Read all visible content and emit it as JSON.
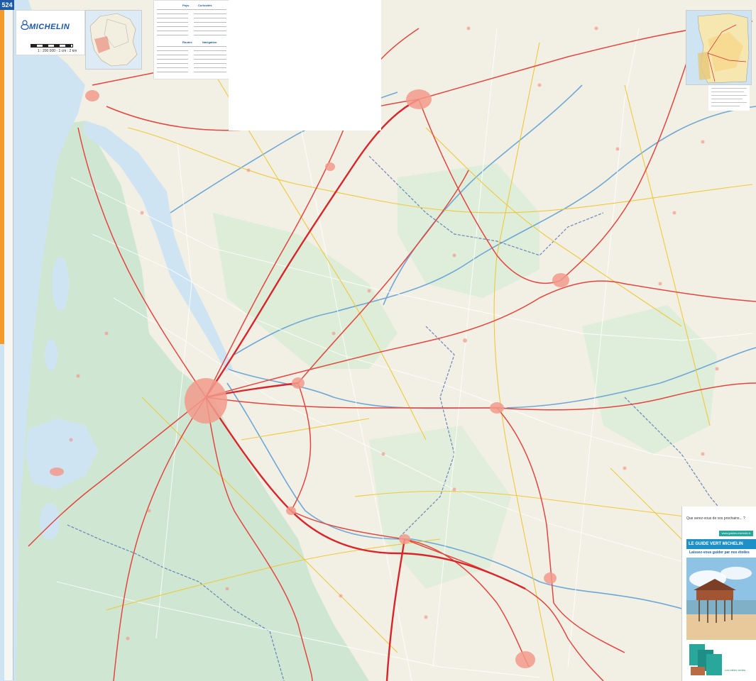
{
  "brand": {
    "name": "MICHELIN",
    "scale": "1 : 200 000 - 1 cm : 2 km",
    "page_tag": "524"
  },
  "legend": {
    "sections": [
      "Pays",
      "Curiosités",
      "Routes",
      "Navigation"
    ]
  },
  "promo": {
    "question": "Que serez-vous de vos prochains... ?",
    "badge": "www.guides.michelin.fr",
    "band": "LE GUIDE VERT MICHELIN",
    "tagline": "Laissez-vous guider par nos étoiles",
    "footer": "Les idées vertes"
  },
  "colors": {
    "sea": "#cfe4f2",
    "forest": "#cbe6cf",
    "land": "#f2f0e4",
    "motorway": "#d9252a",
    "main_road": "#e4453f",
    "secondary": "#f0c83a",
    "minor": "#ffffff",
    "urban": "#f29a8c",
    "boundary": "#4a6bb0",
    "river": "#6fa8d6",
    "brand_blue": "#1f5aa6",
    "accent_orange": "#f39a2a"
  },
  "icons": [
    "michelin-mark-icon",
    "france-inset-map",
    "region-inset-map"
  ]
}
